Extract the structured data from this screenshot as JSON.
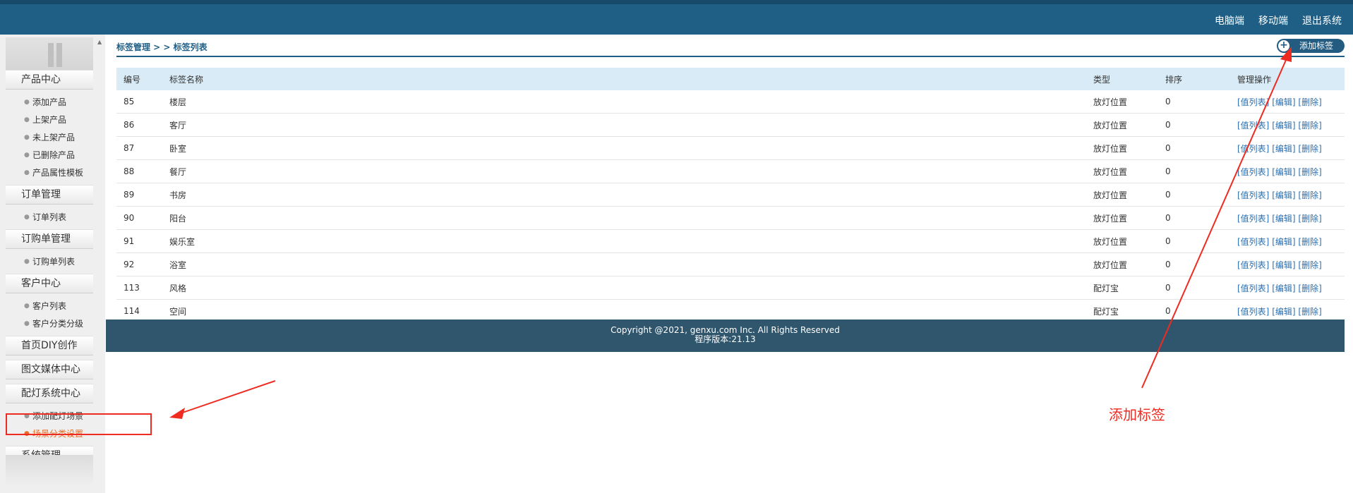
{
  "top_links": [
    "电脑端",
    "移动端",
    "退出系统"
  ],
  "sidebar": {
    "groups": [
      {
        "label": "产品中心",
        "items": [
          "添加产品",
          "上架产品",
          "未上架产品",
          "已删除产品",
          "产品属性模板"
        ]
      },
      {
        "label": "订单管理",
        "items": [
          "订单列表"
        ]
      },
      {
        "label": "订购单管理",
        "items": [
          "订购单列表"
        ]
      },
      {
        "label": "客户中心",
        "items": [
          "客户列表",
          "客户分类分级"
        ]
      },
      {
        "label": "首页DIY创作",
        "items": []
      },
      {
        "label": "图文媒体中心",
        "items": []
      },
      {
        "label": "配灯系统中心",
        "items": [
          "添加配灯场景",
          "场景分类设置"
        ]
      },
      {
        "label": "系统管理",
        "items": []
      }
    ],
    "active_item": "场景分类设置"
  },
  "breadcrumb": "标签管理 > > 标签列表",
  "add_button": "添加标签",
  "table": {
    "headers": [
      "编号",
      "标签名称",
      "类型",
      "排序",
      "管理操作"
    ],
    "rows": [
      [
        "85",
        "楼层",
        "放灯位置",
        "0"
      ],
      [
        "86",
        "客厅",
        "放灯位置",
        "0"
      ],
      [
        "87",
        "卧室",
        "放灯位置",
        "0"
      ],
      [
        "88",
        "餐厅",
        "放灯位置",
        "0"
      ],
      [
        "89",
        "书房",
        "放灯位置",
        "0"
      ],
      [
        "90",
        "阳台",
        "放灯位置",
        "0"
      ],
      [
        "91",
        "娱乐室",
        "放灯位置",
        "0"
      ],
      [
        "92",
        "浴室",
        "放灯位置",
        "0"
      ],
      [
        "113",
        "风格",
        "配灯宝",
        "0"
      ],
      [
        "114",
        "空间",
        "配灯宝",
        "0"
      ]
    ],
    "ops": [
      "[值列表]",
      "[编辑]",
      "[删除]"
    ]
  },
  "footer": {
    "line1": "Copyright @2021, genxu.com Inc. All Rights Reserved",
    "line2": "程序版本:21.13"
  },
  "annotation_label": "添加标签",
  "colors": {
    "header_blue": "#1f5f86",
    "annotation_red": "#ef2b21",
    "active_orange": "#e4712b"
  }
}
